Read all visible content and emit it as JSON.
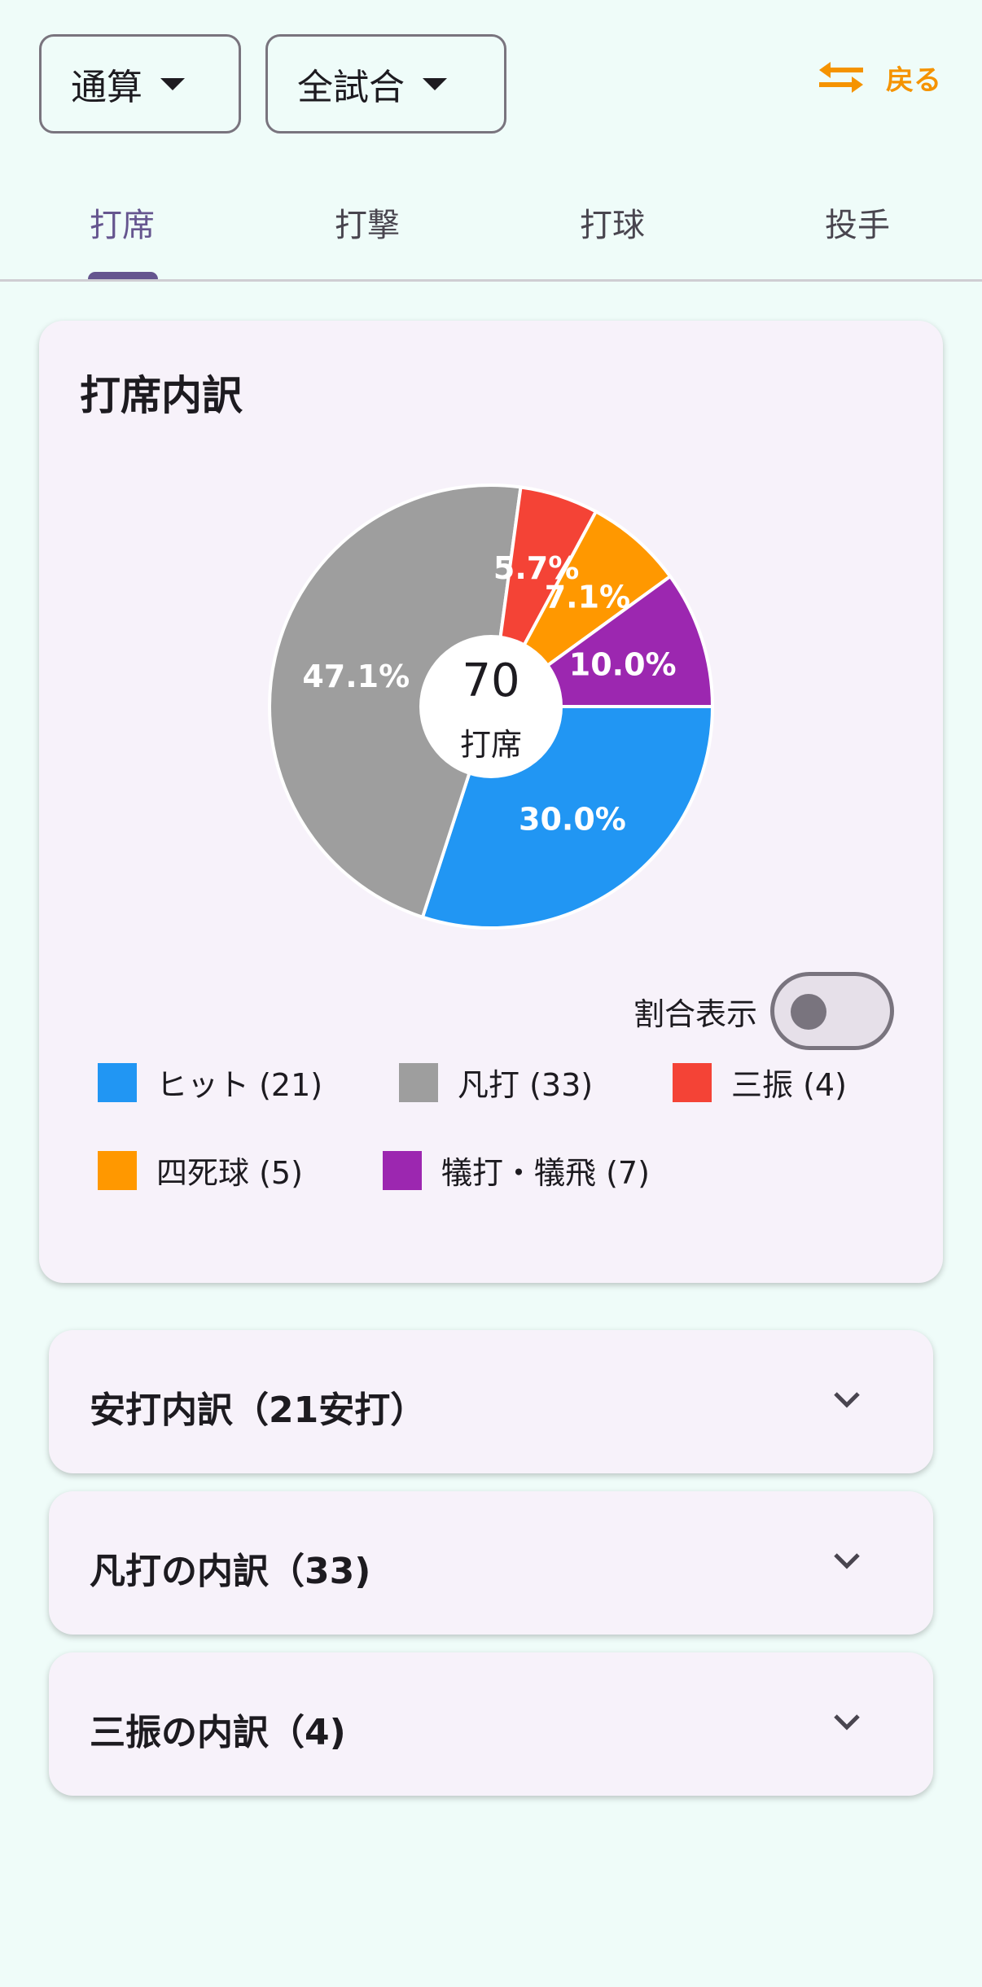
{
  "filters": {
    "scope": "通算",
    "games": "全試合"
  },
  "swap": {
    "label": "戻る",
    "icon": "swap-arrows-icon"
  },
  "tabs": [
    {
      "label": "打席"
    },
    {
      "label": "打撃"
    },
    {
      "label": "打球"
    },
    {
      "label": "投手"
    }
  ],
  "active_tab": 0,
  "card": {
    "title": "打席内訳",
    "center_value": "70",
    "center_label": "打席",
    "toggle_label": "割合表示",
    "toggle_on": false
  },
  "chart_data": {
    "type": "pie",
    "categories": [
      "ヒット",
      "凡打",
      "三振",
      "四死球",
      "犠打・犠飛"
    ],
    "values": [
      21,
      33,
      4,
      5,
      7
    ],
    "percent_labels": [
      "30.0%",
      "47.1%",
      "5.7%",
      "7.1%",
      "10.0%"
    ],
    "colors": [
      "#2196f3",
      "#9e9e9e",
      "#f44336",
      "#ff9800",
      "#9c27b0"
    ],
    "donut": true
  },
  "legend": [
    {
      "label": "ヒット (21)",
      "color": "#2196f3"
    },
    {
      "label": "凡打 (33)",
      "color": "#9e9e9e"
    },
    {
      "label": "三振 (4)",
      "color": "#f44336"
    },
    {
      "label": "四死球 (5)",
      "color": "#ff9800"
    },
    {
      "label": "犠打・犠飛 (7)",
      "color": "#9c27b0"
    }
  ],
  "accordions": [
    {
      "title": "安打内訳（21安打）"
    },
    {
      "title": "凡打の内訳（33)"
    },
    {
      "title": "三振の内訳（4)"
    }
  ]
}
